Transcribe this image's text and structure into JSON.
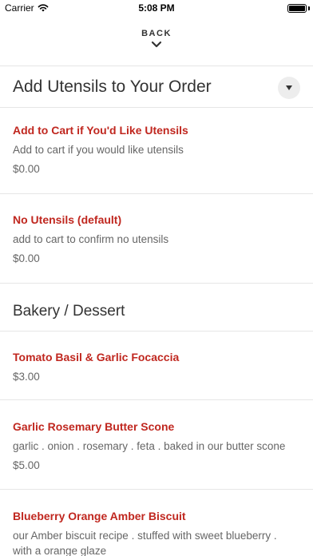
{
  "status_bar": {
    "carrier": "Carrier",
    "time": "5:08 PM",
    "icons": [
      "wifi-icon",
      "battery-icon"
    ]
  },
  "nav": {
    "back_label": "BACK",
    "icon": "chevron-down-icon"
  },
  "sections": [
    {
      "title": "Add Utensils to Your Order",
      "toggle_icon": "triangle-down-icon",
      "items": [
        {
          "name": "Add to Cart if You'd Like Utensils",
          "description": "Add to cart if you would like utensils",
          "price": "$0.00"
        },
        {
          "name": "No Utensils (default)",
          "description": "add to cart to confirm no utensils",
          "price": "$0.00"
        }
      ]
    },
    {
      "title": "Bakery / Dessert",
      "items": [
        {
          "name": "Tomato Basil & Garlic Focaccia",
          "price": "$3.00"
        },
        {
          "name": "Garlic Rosemary Butter Scone",
          "description": "garlic . onion . rosemary . feta . baked in our butter scone",
          "price": "$5.00"
        },
        {
          "name": "Blueberry Orange Amber Biscuit",
          "description_line1": "our Amber biscuit recipe . stuffed with sweet blueberry .",
          "description_line2": "with a orange glaze"
        }
      ]
    }
  ],
  "colors": {
    "item_name": "#c0271f",
    "secondary_text": "#666666",
    "divider": "#e6e6e6"
  }
}
